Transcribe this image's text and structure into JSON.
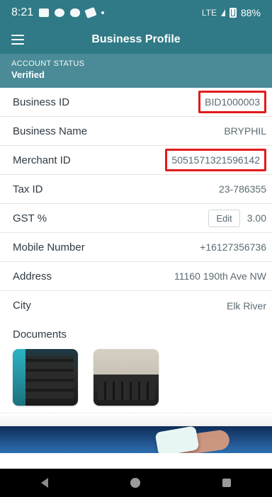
{
  "status_bar": {
    "time": "8:21",
    "network": "LTE",
    "battery": "88%"
  },
  "app_bar": {
    "title": "Business Profile"
  },
  "account_status": {
    "label": "ACCOUNT STATUS",
    "value": "Verified"
  },
  "fields": {
    "business_id": {
      "label": "Business ID",
      "value": "BID1000003"
    },
    "business_name": {
      "label": "Business Name",
      "value": "BRYPHIL"
    },
    "merchant_id": {
      "label": "Merchant ID",
      "value": "5051571321596142"
    },
    "tax_id": {
      "label": "Tax ID",
      "value": "23-786355"
    },
    "gst": {
      "label": "GST %",
      "edit_label": "Edit",
      "value": "3.00"
    },
    "mobile_number": {
      "label": "Mobile Number",
      "value": "+16127356736"
    },
    "address": {
      "label": "Address",
      "value": "11160 190th Ave NW"
    },
    "city": {
      "label": "City",
      "value": "Elk River"
    }
  },
  "documents": {
    "label": "Documents",
    "items": [
      "document-1-image",
      "document-2-image"
    ]
  },
  "colors": {
    "header": "#2f7a86",
    "account_strip": "#4a8b97",
    "highlight_border": "#e21b1b"
  }
}
